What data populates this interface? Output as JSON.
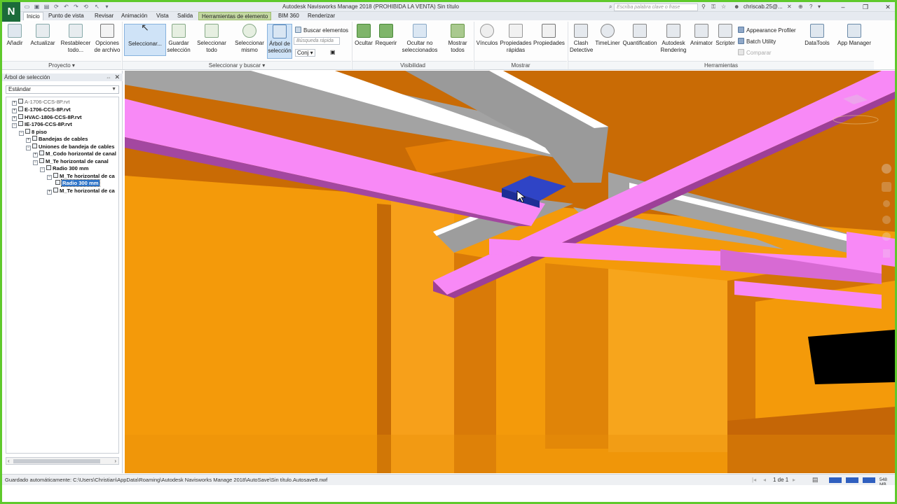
{
  "app": {
    "logo_letter": "N",
    "title": "Autodesk Navisworks Manage 2018 (PROHIBIDA LA VENTA)   Sin título",
    "search_placeholder": "Escriba palabra clave o frase",
    "user": "chriscab.25@...",
    "accent_green": "#5fc92c"
  },
  "tabs": [
    {
      "label": "Inicio",
      "state": "active"
    },
    {
      "label": "Punto de vista",
      "state": ""
    },
    {
      "label": "Revisar",
      "state": ""
    },
    {
      "label": "Animación",
      "state": ""
    },
    {
      "label": "Vista",
      "state": ""
    },
    {
      "label": "Salida",
      "state": ""
    },
    {
      "label": "Herramientas de elemento",
      "state": "highlight"
    },
    {
      "label": "BIM 360",
      "state": ""
    },
    {
      "label": "Renderizar",
      "state": ""
    }
  ],
  "ribbon": {
    "proyecto": {
      "panel_label": "Proyecto ▾",
      "anadir": "Añadir",
      "actualizar": "Actualizar",
      "restablecer": "Restablecer todo...",
      "opciones": "Opciones de archivo"
    },
    "seleccionar": {
      "panel_label": "Seleccionar y buscar ▾",
      "seleccionar": "Seleccionar...",
      "guardar": "Guardar selección",
      "seleccionar_todo": "Seleccionar todo",
      "seleccionar_mismo": "Seleccionar mismo",
      "arbol": "Árbol de selección",
      "buscar": "Buscar elementos",
      "busqueda_rapida": "Búsqueda rápida",
      "conj": "Conj"
    },
    "visibilidad": {
      "panel_label": "Visibilidad",
      "ocultar": "Ocultar",
      "requerir": "Requerir",
      "ocultar_no_sel": "Ocultar no seleccionados",
      "mostrar_todos": "Mostrar todos"
    },
    "mostrar": {
      "panel_label": "Mostrar",
      "vinculos": "Vínculos",
      "propiedades_rapidas": "Propiedades rápidas",
      "propiedades": "Propiedades"
    },
    "herramientas": {
      "panel_label": "Herramientas",
      "clash": "Clash Detective",
      "timeliner": "TimeLiner",
      "quantification": "Quantification",
      "rendering": "Autodesk Rendering",
      "animator": "Animator",
      "scripter": "Scripter",
      "appearance": "Appearance Profiler",
      "batch": "Batch Utility",
      "comparar": "Comparar",
      "datatools": "DataTools",
      "appmanager": "App Manager"
    }
  },
  "selection_tree": {
    "title": "Árbol de selección",
    "mode": "Estándar",
    "nodes": [
      {
        "label": "A-1706-CCS-8P.rvt",
        "bold": false,
        "selected": false
      },
      {
        "label": "E-1706-CCS-8P.rvt",
        "bold": true,
        "selected": false
      },
      {
        "label": "HVAC-1806-CCS-8P.rvt",
        "bold": true,
        "selected": false
      },
      {
        "label": "IE-1706-CCS-8P.rvt",
        "bold": true,
        "selected": false
      },
      {
        "label": "8 piso",
        "bold": true,
        "selected": false
      },
      {
        "label": "Bandejas de cables",
        "bold": true,
        "selected": false
      },
      {
        "label": "Uniones de bandeja de cables",
        "bold": true,
        "selected": false
      },
      {
        "label": "M_Codo horizontal de canal",
        "bold": true,
        "selected": false
      },
      {
        "label": "M_Te horizontal de canal",
        "bold": true,
        "selected": false
      },
      {
        "label": "Radio 300 mm",
        "bold": true,
        "selected": false
      },
      {
        "label": "M_Te horizontal de ca",
        "bold": true,
        "selected": false
      },
      {
        "label": "Radio 300 mm",
        "bold": true,
        "selected": true
      },
      {
        "label": "M_Te horizontal de ca",
        "bold": true,
        "selected": false
      }
    ]
  },
  "status": {
    "autosave": "Guardado automáticamente: C:\\Users\\Christian\\AppData\\Roaming\\Autodesk Navisworks Manage 2018\\AutoSave\\Sin título.Autosave8.nwf",
    "page": "1 de 1",
    "memory": "548 MB"
  },
  "viewport_colors": {
    "orange": "#f49a0a",
    "orange_dark": "#c96b05",
    "magenta": "#f889f6",
    "grey": "#a3a3a3",
    "selected_blue": "#2f44c6"
  }
}
